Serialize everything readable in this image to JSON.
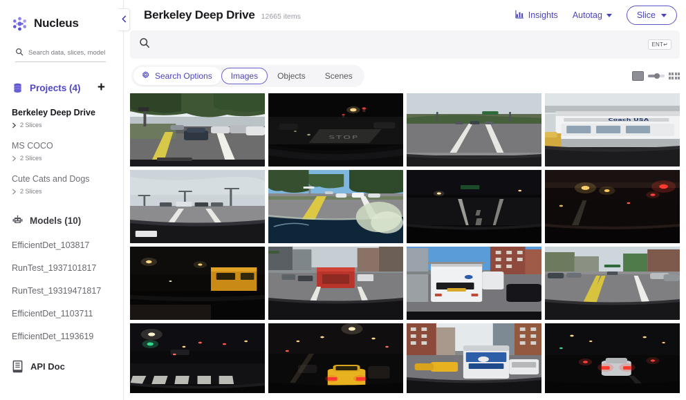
{
  "brand": {
    "name": "Nucleus",
    "logo_icon": "nucleus-logo"
  },
  "sidebar": {
    "search": {
      "placeholder": "Search data, slices, model",
      "value": "",
      "icon": "search-icon"
    },
    "projects_section": {
      "label": "Projects (4)",
      "icon": "database-icon",
      "add_label": "+"
    },
    "projects": [
      {
        "name": "Berkeley Deep Drive",
        "slices": "2 Slices",
        "active": true
      },
      {
        "name": "MS COCO",
        "slices": "2 Slices",
        "active": false
      },
      {
        "name": "Cute Cats and Dogs",
        "slices": "2 Slices",
        "active": false
      }
    ],
    "models_section": {
      "label": "Models (10)",
      "icon": "robot-icon"
    },
    "models": [
      {
        "name": "EfficientDet_103817"
      },
      {
        "name": "RunTest_1937101817"
      },
      {
        "name": "RunTest_19319471817"
      },
      {
        "name": "EfficientDet_1103711"
      },
      {
        "name": "EfficientDet_1193619"
      }
    ],
    "api_doc": {
      "label": "API Doc",
      "icon": "book-icon"
    },
    "collapse": {
      "icon": "chevron-left-icon"
    }
  },
  "header": {
    "title": "Berkeley Deep Drive",
    "item_count": "12665 items",
    "insights": {
      "label": "Insights",
      "icon": "bar-chart-icon"
    },
    "autotag": {
      "label": "Autotag",
      "icon": "chevron-down-icon"
    },
    "slice": {
      "label": "Slice",
      "icon": "chevron-down-icon"
    }
  },
  "search": {
    "placeholder": "",
    "value": "",
    "icon": "search-icon",
    "enter_hint": "ENT↵"
  },
  "toolbar": {
    "search_options": {
      "label": "Search Options",
      "icon": "gear-icon"
    },
    "tabs": [
      {
        "label": "Images",
        "active": true
      },
      {
        "label": "Objects",
        "active": false
      },
      {
        "label": "Scenes",
        "active": false
      }
    ],
    "size_slider": {
      "large_icon": "large-thumbnail-icon",
      "small_icon": "small-thumbnail-grid-icon",
      "value": 45
    }
  },
  "colors": {
    "accent": "#4a43bd",
    "accent_border": "#5b53c9",
    "panel": "#f5f5f7",
    "text": "#18181d",
    "muted": "#6e6e77"
  },
  "grid": {
    "columns": 4,
    "items": [
      {
        "id": 1,
        "scene": "daytime tree-lined street, parked cars both sides, yellow center line"
      },
      {
        "id": 2,
        "scene": "night road with STOP painted on asphalt, dark intersection"
      },
      {
        "id": 3,
        "scene": "overcast highway with cars ahead, green sign"
      },
      {
        "id": 4,
        "scene": "Coach USA bus at depot, daytime"
      },
      {
        "id": 5,
        "scene": "overcast bridge road with traffic ahead, dashboard visible"
      },
      {
        "id": 6,
        "scene": "sunny divided highway, reflection of dashboard objects on windshield"
      },
      {
        "id": 7,
        "scene": "dark night highway, lane markings, green overhead sign"
      },
      {
        "id": 8,
        "scene": "night underpass with red traffic light and street lamps"
      },
      {
        "id": 9,
        "scene": "night street, yellow truck on right, dark road"
      },
      {
        "id": 10,
        "scene": "city street with red truck and buildings, daytime"
      },
      {
        "id": 11,
        "scene": "white utility van ahead, brick buildings, blue sky"
      },
      {
        "id": 12,
        "scene": "suburban street with parked cars, cloudy sky"
      },
      {
        "id": 13,
        "scene": "night city intersection with crosswalk and green light"
      },
      {
        "id": 14,
        "scene": "night city street with yellow taxi and brake lights"
      },
      {
        "id": 15,
        "scene": "daytime city street with blue city bus and taxis"
      },
      {
        "id": 16,
        "scene": "night road with red brake lights ahead"
      }
    ]
  }
}
